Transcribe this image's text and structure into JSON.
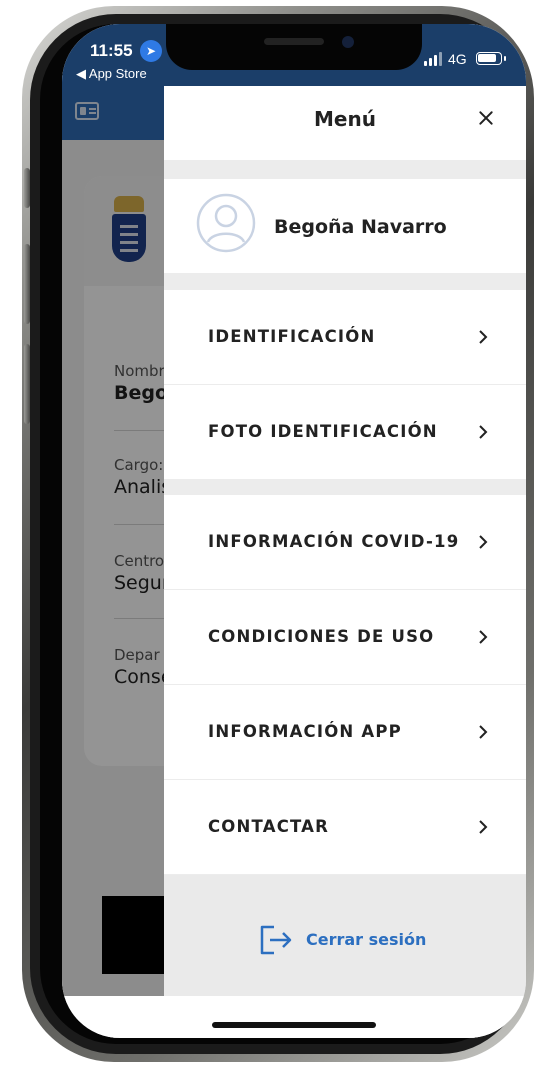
{
  "status_bar": {
    "time": "11:55",
    "back_link": "◀ App Store",
    "network": "4G"
  },
  "background_card": {
    "fields": [
      {
        "label": "Nombr",
        "value": "Bego"
      },
      {
        "label": "Cargo:",
        "value": "Analis"
      },
      {
        "label": "Centro",
        "value": "Segur"
      },
      {
        "label": "Depar",
        "value": "Conse"
      }
    ]
  },
  "drawer": {
    "title": "Menú",
    "user_name": "Begoña Navarro",
    "items": [
      {
        "label": "IDENTIFICACIÓN"
      },
      {
        "label": "FOTO IDENTIFICACIÓN"
      },
      {
        "label": "INFORMACIÓN COVID-19"
      },
      {
        "label": "CONDICIONES DE USO"
      },
      {
        "label": "INFORMACIÓN APP"
      },
      {
        "label": "CONTACTAR"
      }
    ],
    "logout_label": "Cerrar sesión"
  },
  "colors": {
    "header_blue": "#2f6bb5",
    "link_blue": "#2c6fc0",
    "text_dark": "#222222"
  },
  "icons": [
    "location-arrow-icon",
    "id-card-icon",
    "close-icon",
    "avatar-icon",
    "chevron-right-icon",
    "logout-icon"
  ]
}
